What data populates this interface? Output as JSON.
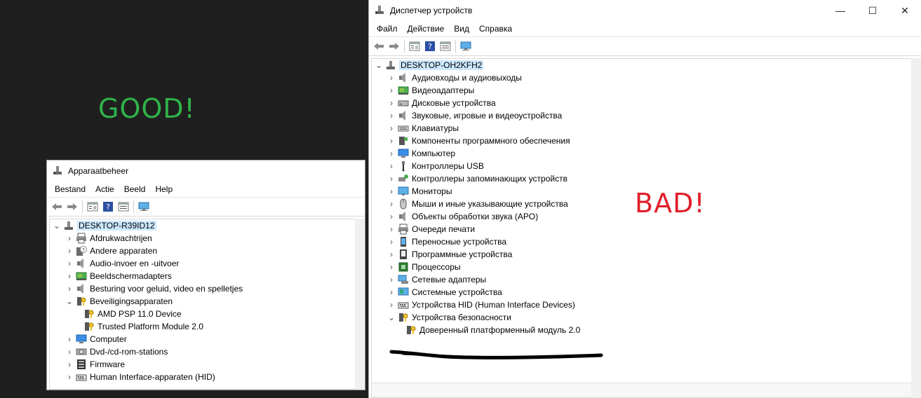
{
  "annotations": {
    "good": "GOOD!",
    "bad": "BAD!"
  },
  "colors": {
    "good": "#2fb34a",
    "bad": "#e0202a",
    "selection": "#cce8ff"
  },
  "window_nl": {
    "title": "Apparaatbeheer",
    "menu": [
      "Bestand",
      "Actie",
      "Beeld",
      "Help"
    ],
    "root": "DESKTOP-R39ID12",
    "items": [
      {
        "label": "Afdrukwachtrijen",
        "icon": "printer-icon",
        "expanded": false
      },
      {
        "label": "Andere apparaten",
        "icon": "unknown-device-icon",
        "expanded": false
      },
      {
        "label": "Audio-invoer en -uitvoer",
        "icon": "speaker-icon",
        "expanded": false
      },
      {
        "label": "Beeldschermadapters",
        "icon": "display-adapter-icon",
        "expanded": false
      },
      {
        "label": "Besturing voor geluid, video en spelletjes",
        "icon": "speaker-icon",
        "expanded": false
      },
      {
        "label": "Beveiligingsapparaten",
        "icon": "security-key-icon",
        "expanded": true
      },
      {
        "label": "AMD PSP 11.0 Device",
        "icon": "security-key-icon",
        "child": true
      },
      {
        "label": "Trusted Platform Module 2.0",
        "icon": "security-key-icon",
        "child": true
      },
      {
        "label": "Computer",
        "icon": "computer-icon",
        "expanded": false
      },
      {
        "label": "Dvd-/cd-rom-stations",
        "icon": "dvd-drive-icon",
        "expanded": false
      },
      {
        "label": "Firmware",
        "icon": "firmware-icon",
        "expanded": false
      },
      {
        "label": "Human Interface-apparaten (HID)",
        "icon": "hid-icon",
        "expanded": false
      }
    ]
  },
  "window_ru": {
    "title": "Диспетчер устройств",
    "menu": [
      "Файл",
      "Действие",
      "Вид",
      "Справка"
    ],
    "window_buttons": {
      "minimize": "—",
      "maximize": "☐",
      "close": "✕"
    },
    "root": "DESKTOP-OH2KFH2",
    "items": [
      {
        "label": "Аудиовходы и аудиовыходы",
        "icon": "speaker-icon",
        "expanded": false
      },
      {
        "label": "Видеоадаптеры",
        "icon": "display-adapter-icon",
        "expanded": false
      },
      {
        "label": "Дисковые устройства",
        "icon": "disk-drive-icon",
        "expanded": false
      },
      {
        "label": "Звуковые, игровые и видеоустройства",
        "icon": "speaker-icon",
        "expanded": false
      },
      {
        "label": "Клавиатуры",
        "icon": "keyboard-icon",
        "expanded": false
      },
      {
        "label": "Компоненты программного обеспечения",
        "icon": "software-component-icon",
        "expanded": false
      },
      {
        "label": "Компьютер",
        "icon": "computer-icon",
        "expanded": false
      },
      {
        "label": "Контроллеры USB",
        "icon": "usb-icon",
        "expanded": false
      },
      {
        "label": "Контроллеры запоминающих устройств",
        "icon": "storage-controller-icon",
        "expanded": false
      },
      {
        "label": "Мониторы",
        "icon": "monitor-icon",
        "expanded": false
      },
      {
        "label": "Мыши и иные указывающие устройства",
        "icon": "mouse-icon",
        "expanded": false
      },
      {
        "label": "Объекты обработки звука (APO)",
        "icon": "speaker-icon",
        "expanded": false
      },
      {
        "label": "Очереди печати",
        "icon": "printer-icon",
        "expanded": false
      },
      {
        "label": "Переносные устройства",
        "icon": "portable-device-icon",
        "expanded": false
      },
      {
        "label": "Программные устройства",
        "icon": "software-device-icon",
        "expanded": false
      },
      {
        "label": "Процессоры",
        "icon": "processor-icon",
        "expanded": false
      },
      {
        "label": "Сетевые адаптеры",
        "icon": "network-adapter-icon",
        "expanded": false
      },
      {
        "label": "Системные устройства",
        "icon": "system-device-icon",
        "expanded": false
      },
      {
        "label": "Устройства HID (Human Interface Devices)",
        "icon": "hid-icon",
        "expanded": false
      },
      {
        "label": "Устройства безопасности",
        "icon": "security-key-icon",
        "expanded": true
      },
      {
        "label": "Доверенный платформенный модуль 2.0",
        "icon": "security-key-icon",
        "child": true
      }
    ]
  }
}
